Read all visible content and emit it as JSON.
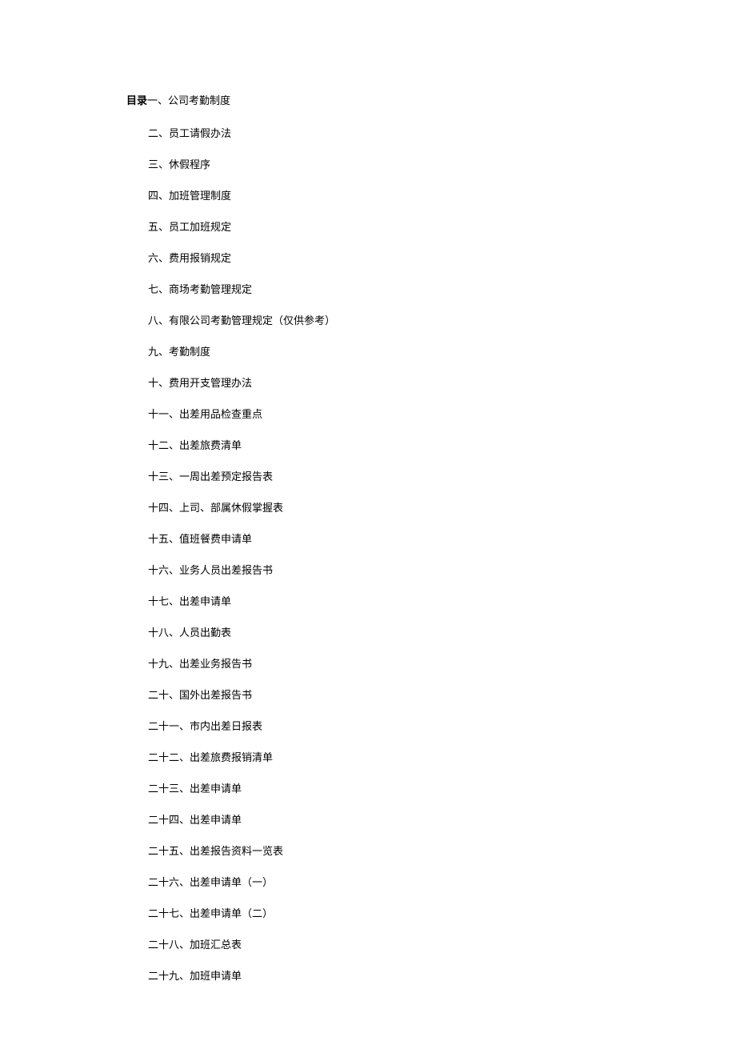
{
  "heading": "目录",
  "items": [
    "一、公司考勤制度",
    "二、员工请假办法",
    "三、休假程序",
    "四、加班管理制度",
    "五、员工加班规定",
    "六、费用报销规定",
    "七、商场考勤管理规定",
    "八、有限公司考勤管理规定（仅供参考）",
    "九、考勤制度",
    "十、费用开支管理办法",
    "十一、出差用品检查重点",
    "十二、出差旅费清单",
    "十三、一周出差预定报告表",
    "十四、上司、部属休假掌握表",
    "十五、值班餐费申请单",
    "十六、业务人员出差报告书",
    "十七、出差申请单",
    "十八、人员出勤表",
    "十九、出差业务报告书",
    "二十、国外出差报告书",
    "二十一、市内出差日报表",
    "二十二、出差旅费报销清单",
    "二十三、出差申请单",
    "二十四、出差申请单",
    "二十五、出差报告资料一览表",
    "二十六、出差申请单（一）",
    "二十七、出差申请单（二）",
    "二十八、加班汇总表",
    "二十九、加班申请单"
  ]
}
